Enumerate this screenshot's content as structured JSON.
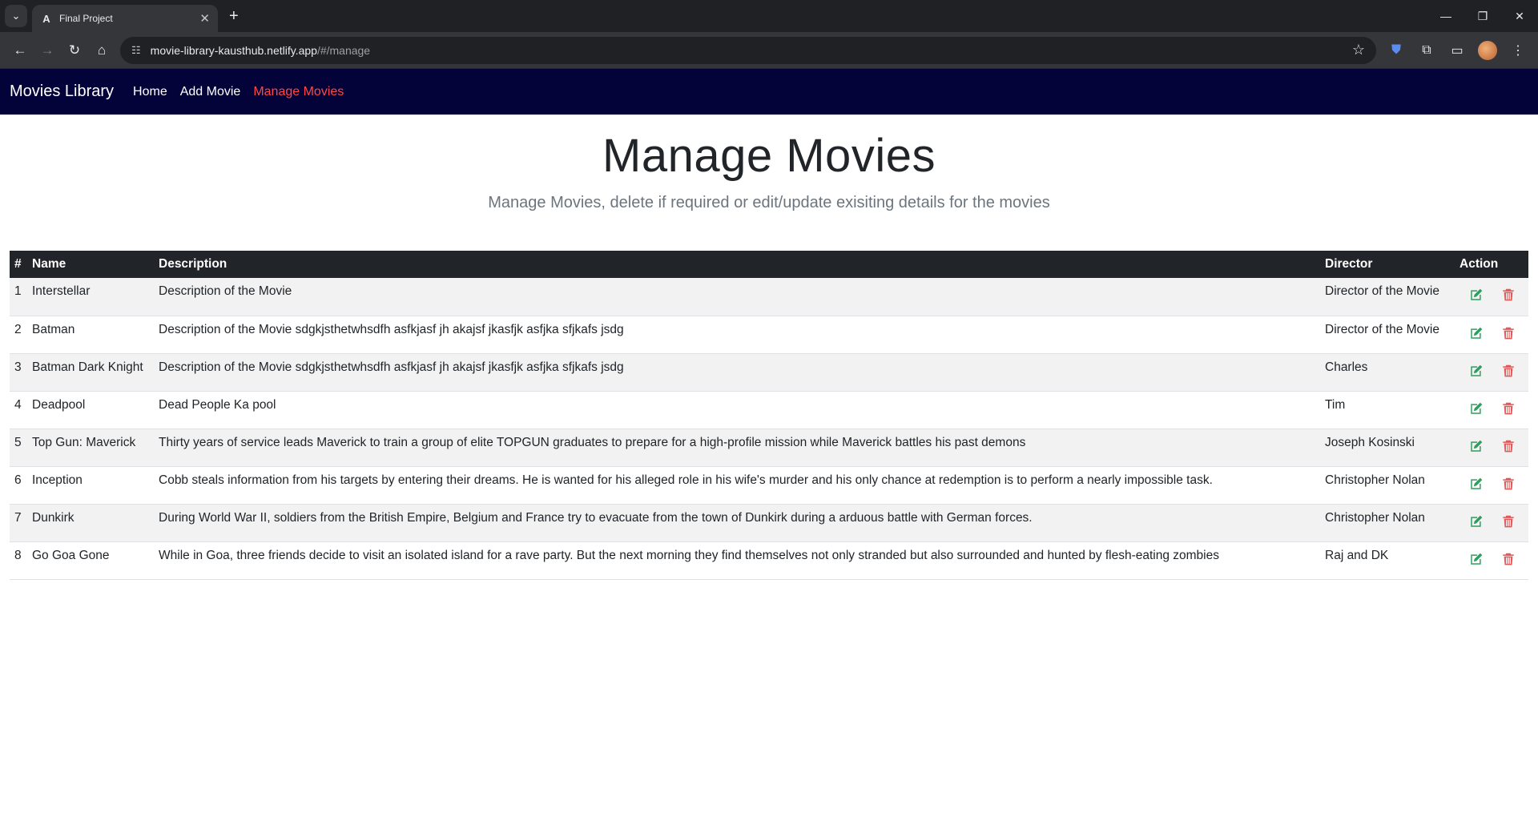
{
  "browser": {
    "tab_title": "Final Project",
    "tab_favicon": "A",
    "url_host": "movie-library-kausthub.netlify.app",
    "url_path": "/#/manage"
  },
  "nav": {
    "brand": "Movies Library",
    "links": [
      {
        "label": "Home"
      },
      {
        "label": "Add Movie"
      },
      {
        "label": "Manage Movies"
      }
    ]
  },
  "hero": {
    "title": "Manage Movies",
    "subtitle": "Manage Movies, delete if required or edit/update exisiting details for the movies"
  },
  "table": {
    "headers": {
      "num": "#",
      "name": "Name",
      "description": "Description",
      "director": "Director",
      "action": "Action"
    },
    "rows": [
      {
        "num": "1",
        "name": "Interstellar",
        "description": "Description of the Movie",
        "director": "Director of the Movie"
      },
      {
        "num": "2",
        "name": "Batman",
        "description": "Description of the Movie sdgkjsthetwhsdfh asfkjasf jh akajsf jkasfjk asfjka sfjkafs jsdg",
        "director": "Director of the Movie"
      },
      {
        "num": "3",
        "name": "Batman Dark Knight",
        "description": "Description of the Movie sdgkjsthetwhsdfh asfkjasf jh akajsf jkasfjk asfjka sfjkafs jsdg",
        "director": "Charles"
      },
      {
        "num": "4",
        "name": "Deadpool",
        "description": "Dead People Ka pool",
        "director": "Tim"
      },
      {
        "num": "5",
        "name": "Top Gun: Maverick",
        "description": "Thirty years of service leads Maverick to train a group of elite TOPGUN graduates to prepare for a high-profile mission while Maverick battles his past demons",
        "director": "Joseph Kosinski"
      },
      {
        "num": "6",
        "name": "Inception",
        "description": "Cobb steals information from his targets by entering their dreams. He is wanted for his alleged role in his wife's murder and his only chance at redemption is to perform a nearly impossible task.",
        "director": "Christopher Nolan"
      },
      {
        "num": "7",
        "name": "Dunkirk",
        "description": "During World War II, soldiers from the British Empire, Belgium and France try to evacuate from the town of Dunkirk during a arduous battle with German forces.",
        "director": "Christopher Nolan"
      },
      {
        "num": "8",
        "name": "Go Goa Gone",
        "description": "While in Goa, three friends decide to visit an isolated island for a rave party. But the next morning they find themselves not only stranded but also surrounded and hunted by flesh-eating zombies",
        "director": "Raj and DK"
      }
    ]
  },
  "colors": {
    "navbar_bg": "#03033a",
    "active_link": "#ff4747",
    "edit_icon": "#2e9d5e",
    "delete_icon": "#e05858"
  }
}
